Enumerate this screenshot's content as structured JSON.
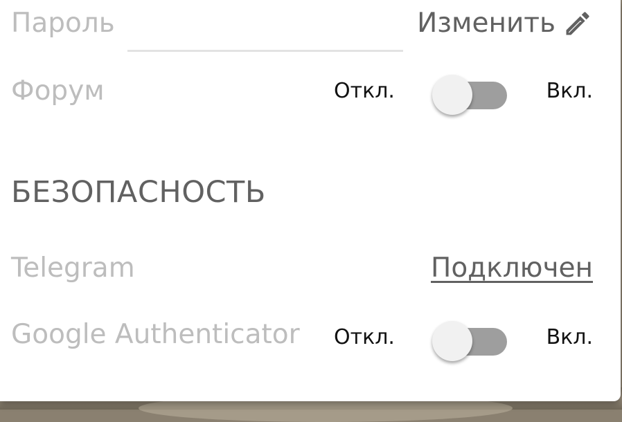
{
  "account": {
    "password": {
      "label": "Пароль",
      "value": "",
      "edit_label": "Изменить",
      "edit_icon": "pencil-icon"
    },
    "forum": {
      "label": "Форум",
      "off_label": "Откл.",
      "on_label": "Вкл.",
      "enabled": false
    }
  },
  "security": {
    "title": "БЕЗОПАСНОСТЬ",
    "telegram": {
      "label": "Telegram",
      "status": "Подключен"
    },
    "google_auth": {
      "label": "Google Authenticator",
      "off_label": "Откл.",
      "on_label": "Вкл.",
      "enabled": false
    }
  },
  "colors": {
    "label": "#bdbdbd",
    "accent_text": "#616161",
    "toggle_track": "#9e9e9e",
    "toggle_thumb": "#f1f1f1"
  }
}
